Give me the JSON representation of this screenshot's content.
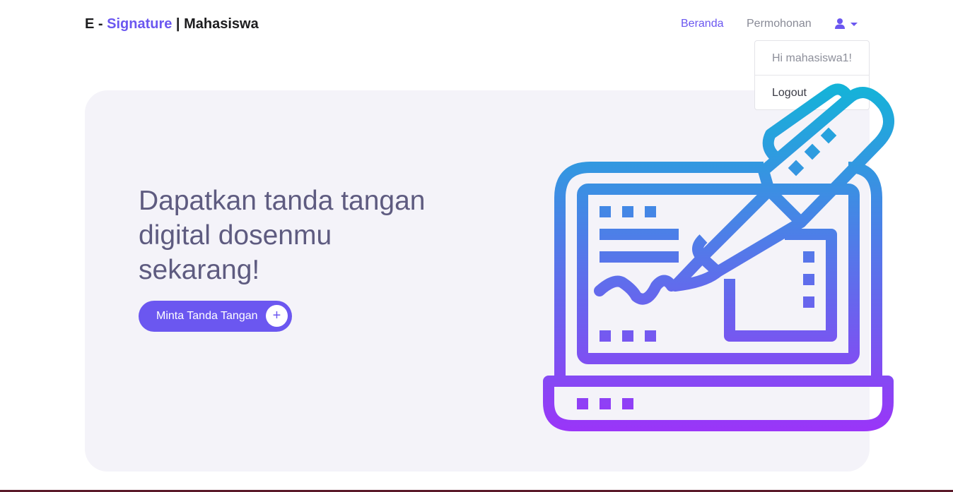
{
  "brand": {
    "prefix": "E - ",
    "accent": "Signature",
    "suffix": " | Mahasiswa"
  },
  "nav": {
    "beranda": "Beranda",
    "permohonan": "Permohonan",
    "user_icon": "user-icon",
    "caret_icon": "caret-down-icon"
  },
  "dropdown": {
    "greeting": "Hi mahasiswa1!",
    "logout": "Logout"
  },
  "hero": {
    "title": "Dapatkan tanda tangan digital dosenmu sekarang!",
    "cta_label": "Minta Tanda Tangan",
    "cta_icon": "plus-icon"
  },
  "colors": {
    "accent": "#6b57f0",
    "hero_bg": "#f4f3f9",
    "title": "#5e5b80",
    "gradient_top": "#12b5d8",
    "gradient_bottom": "#9b34f8"
  }
}
